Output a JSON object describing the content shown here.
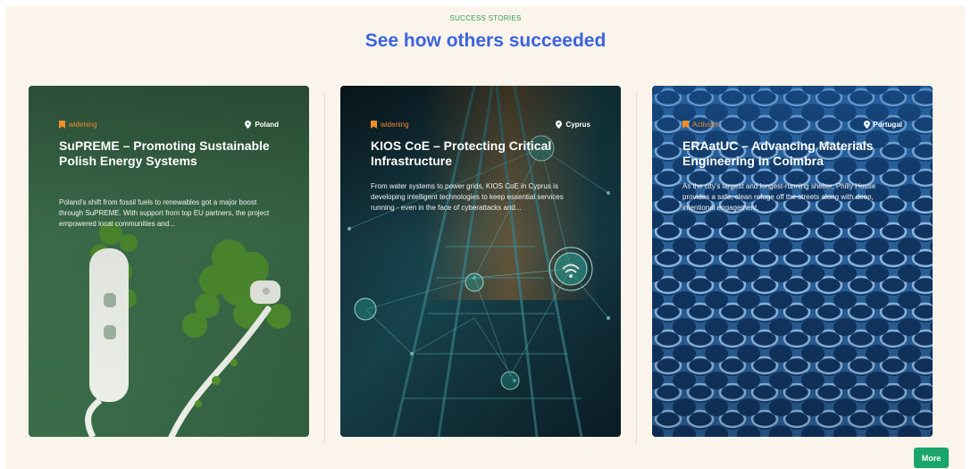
{
  "section": {
    "eyebrow": "SUCCESS STORIES",
    "heading": "See how others succeeded"
  },
  "cards": [
    {
      "tag": "widening",
      "location": "Poland",
      "title": "SuPREME – Promoting Sustainable Polish Energy Systems",
      "description": "Poland's shift from fossil fuels to renewables got a major boost through SuPREME. With support from top EU partners, the project empowered local communities and..."
    },
    {
      "tag": "widening",
      "location": "Cyprus",
      "title": "KIOS CoE – Protecting Critical Infrastructure",
      "description": "From water systems to power grids, KIOS CoE in Cyprus is developing intelligent technologies to keep essential services running - even in the face of cyberattacks and..."
    },
    {
      "tag": "Activism",
      "location": "Portugal",
      "title": "ERAatUC – Advancing Materials Engineering in Coimbra",
      "description": "As the city's largest and longest-running shelter, Philly House provides a safe, clean refuge off the streets along with deep, intentional engagement."
    }
  ],
  "actions": {
    "more_label": "More"
  },
  "colors": {
    "page_background": "#fbf4ea",
    "heading": "#3a63df",
    "eyebrow": "#2fa05a",
    "tag": "#f28b28",
    "more_button": "#1aa56a"
  },
  "icons": {
    "tag": "bookmark-icon",
    "location": "map-pin-icon"
  }
}
